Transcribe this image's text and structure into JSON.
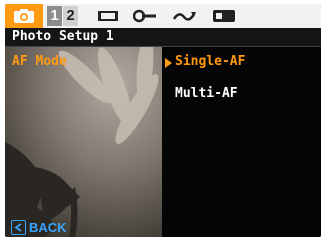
{
  "tabs": {
    "numbers": [
      "1",
      "2"
    ]
  },
  "header": {
    "title": "Photo Setup 1"
  },
  "menu": {
    "selected_item": "AF Mode",
    "options": [
      "Single-AF",
      "Multi-AF"
    ]
  },
  "footer": {
    "back_label": "BACK"
  },
  "colors": {
    "accent": "#ff9a12",
    "back": "#3aa3ff"
  }
}
